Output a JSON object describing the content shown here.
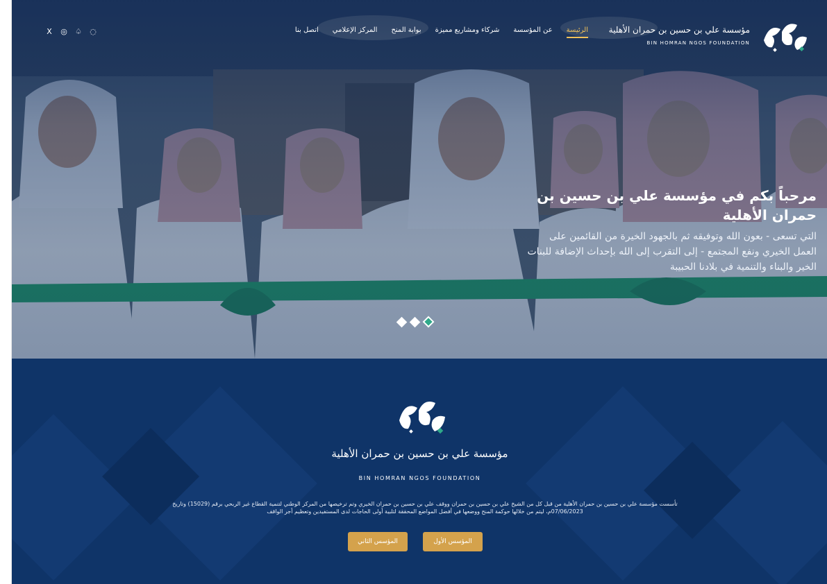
{
  "nav": {
    "social": [
      {
        "icon": "x-icon",
        "glyph": "X"
      },
      {
        "icon": "instagram-icon",
        "glyph": "◎"
      },
      {
        "icon": "snapchat-icon",
        "glyph": "♤"
      },
      {
        "icon": "whatsapp-icon",
        "glyph": "◌"
      }
    ],
    "menu": [
      {
        "label": "الرئيسة",
        "active": true
      },
      {
        "label": "عن المؤسسة",
        "active": false
      },
      {
        "label": "شركاء ومشاريع مميزة",
        "active": false
      },
      {
        "label": "بوابة المنح",
        "active": false
      },
      {
        "label": "المركز الإعلامي",
        "active": false
      },
      {
        "label": "اتصل بنا",
        "active": false
      }
    ],
    "brand_arabic": "مؤسسة علي بن حسين بن حمران الأهلية",
    "brand_latin": "BIN HOMRAN NGOS FOUNDATION"
  },
  "hero": {
    "title": "مرحباً بكم في مؤسسة علي بن حسين بن حمران الأهلية",
    "subtitle": "التي تسعى - بعون الله وتوفيقه ثم بالجهود الخيرة من القائمين على العمل الخيري ونفع المجتمع - إلى التقرب إلى الله بإحداث الإضافة للبنات الخير والبناء والتنمية في بلادنا الحبيبة",
    "slides_count": 3,
    "active_slide": 3
  },
  "about": {
    "brand_arabic": "مؤسسة علي بن حسين بن حمران الأهلية",
    "brand_latin": "BIN HOMRAN NGOS FOUNDATION",
    "description": "تأسست مؤسسة علي بن حسين بن حمران الأهلية من قبل كل من الشيخ علي بن حسين بن حمران ووقف علي بن حسين بن حمران الخيري وتم ترخيصها من المركز الوطني لتنمية القطاع غير الربحي برقم (15029) وتاريخ 07/06/2023م، ليتم من خلالها حوكمة المنح ووضعها في أفضل المواضع المحققة لتلبية أولى الحاجات لدى المستفيدين وتعظيم أجر الواقف",
    "button_first_founder": "المؤسس الأول",
    "button_second_founder": "المؤسس الثاني"
  },
  "colors": {
    "navy": "#0f3468",
    "gold": "#d4a24c",
    "accent_green": "#2fa98a",
    "active_nav": "#f0c15a"
  }
}
